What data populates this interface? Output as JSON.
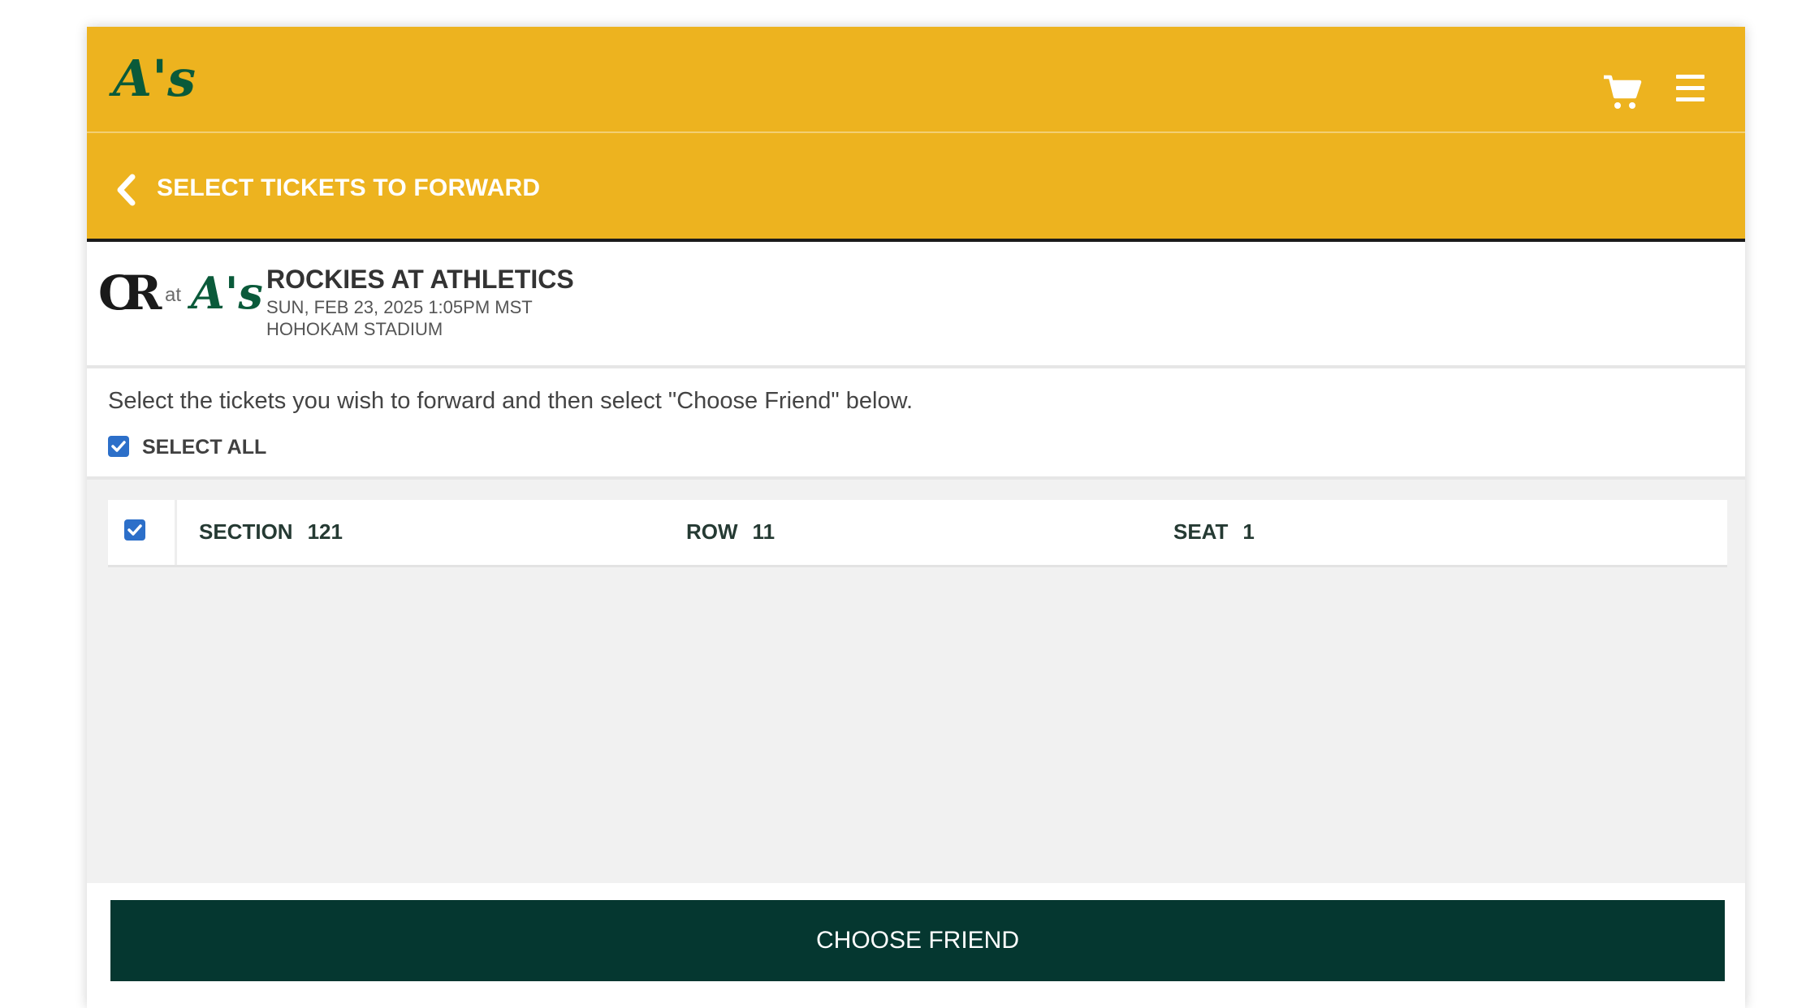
{
  "header": {
    "logo_text": "A's",
    "cart_icon": "cart-icon",
    "menu_icon": "hamburger-menu-icon",
    "brand_color": "#edb31f"
  },
  "subheader": {
    "back_icon": "chevron-left-icon",
    "title": "SELECT TICKETS TO FORWARD"
  },
  "event": {
    "away_logo": "CR",
    "at_label": "at",
    "home_logo": "A's",
    "title": "ROCKIES AT ATHLETICS",
    "datetime": "SUN, FEB 23, 2025 1:05PM MST",
    "venue": "HOHOKAM STADIUM"
  },
  "instructions": {
    "text": "Select the tickets you wish to forward and then select \"Choose Friend\" below.",
    "select_all_label": "SELECT ALL",
    "select_all_checked": true
  },
  "tickets": [
    {
      "checked": true,
      "section_label": "SECTION",
      "section": "121",
      "row_label": "ROW",
      "row": "11",
      "seat_label": "SEAT",
      "seat": "1"
    }
  ],
  "footer": {
    "button_label": "CHOOSE FRIEND",
    "button_color": "#053730"
  }
}
